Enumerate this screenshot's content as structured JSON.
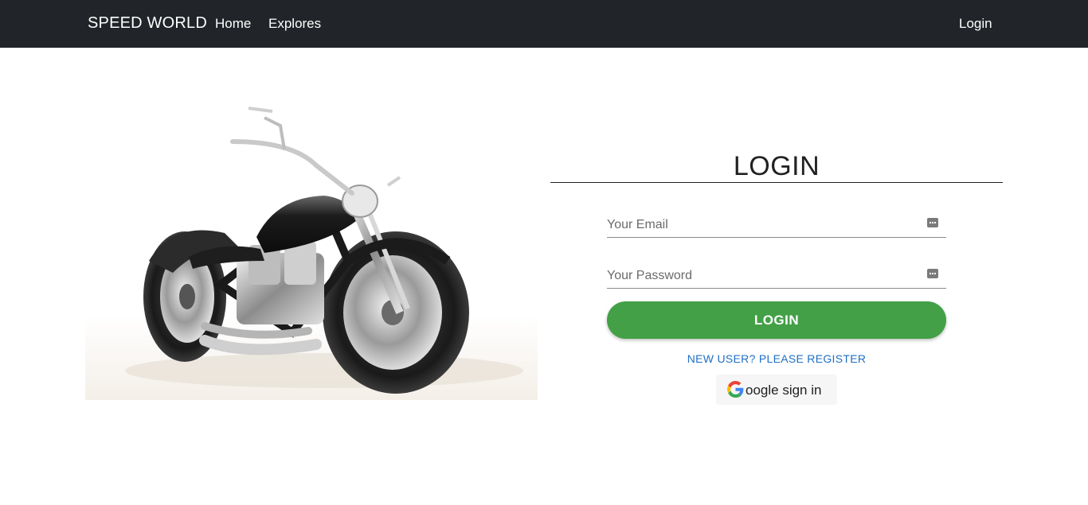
{
  "navbar": {
    "brand": "SPEED WORLD",
    "links": [
      {
        "label": "Home"
      },
      {
        "label": "Explores"
      }
    ],
    "login_label": "Login"
  },
  "hero": {
    "image": "motorcycle-photo"
  },
  "login_form": {
    "title": "LOGIN",
    "email": {
      "placeholder": "Your Email",
      "value": "",
      "icon": "password-manager-icon"
    },
    "password": {
      "placeholder": "Your Password",
      "value": "",
      "icon": "password-manager-icon"
    },
    "submit_label": "LOGIN",
    "register_link": "NEW USER? PLEASE REGISTER",
    "google_button": {
      "label": "oogle sign in",
      "icon": "google-icon"
    }
  },
  "colors": {
    "navbar_bg": "#212529",
    "login_button": "#43a047",
    "register_link": "#1e6fc4"
  }
}
